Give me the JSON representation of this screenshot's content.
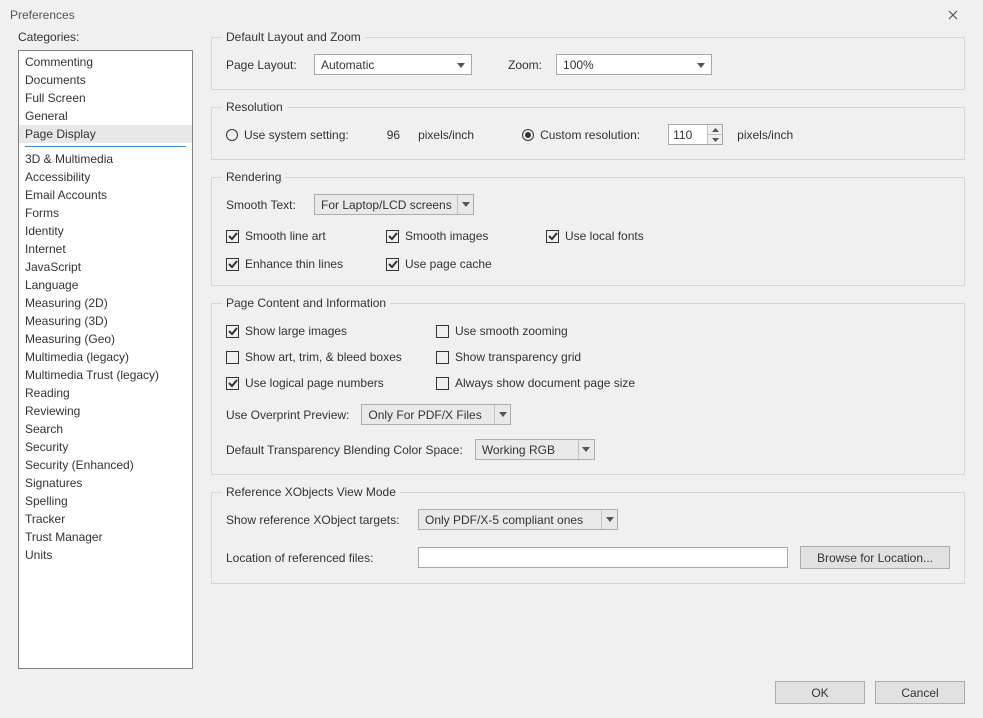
{
  "window": {
    "title": "Preferences"
  },
  "sidebar": {
    "label": "Categories:",
    "top": [
      "Commenting",
      "Documents",
      "Full Screen",
      "General",
      "Page Display"
    ],
    "selected": "Page Display",
    "rest": [
      "3D & Multimedia",
      "Accessibility",
      "Email Accounts",
      "Forms",
      "Identity",
      "Internet",
      "JavaScript",
      "Language",
      "Measuring (2D)",
      "Measuring (3D)",
      "Measuring (Geo)",
      "Multimedia (legacy)",
      "Multimedia Trust (legacy)",
      "Reading",
      "Reviewing",
      "Search",
      "Security",
      "Security (Enhanced)",
      "Signatures",
      "Spelling",
      "Tracker",
      "Trust Manager",
      "Units"
    ]
  },
  "layoutZoom": {
    "legend": "Default Layout and Zoom",
    "pageLayoutLabel": "Page Layout:",
    "pageLayoutValue": "Automatic",
    "zoomLabel": "Zoom:",
    "zoomValue": "100%"
  },
  "resolution": {
    "legend": "Resolution",
    "useSystemLabel": "Use system setting:",
    "systemValue": "96",
    "systemUnit": "pixels/inch",
    "customLabel": "Custom resolution:",
    "customValue": "110",
    "customUnit": "pixels/inch"
  },
  "rendering": {
    "legend": "Rendering",
    "smoothTextLabel": "Smooth Text:",
    "smoothTextValue": "For Laptop/LCD screens",
    "smoothLineArt": "Smooth line art",
    "smoothImages": "Smooth images",
    "useLocalFonts": "Use local fonts",
    "enhanceThinLines": "Enhance thin lines",
    "usePageCache": "Use page cache"
  },
  "pageContent": {
    "legend": "Page Content and Information",
    "showLargeImages": "Show large images",
    "useSmoothZoom": "Use smooth zooming",
    "showArtTrim": "Show art, trim, & bleed boxes",
    "showTransGrid": "Show transparency grid",
    "useLogicalPages": "Use logical page numbers",
    "alwaysShowSize": "Always show document page size",
    "overprintLabel": "Use Overprint Preview:",
    "overprintValue": "Only For PDF/X Files",
    "blendLabel": "Default Transparency Blending Color Space:",
    "blendValue": "Working RGB"
  },
  "xobjects": {
    "legend": "Reference XObjects View Mode",
    "targetsLabel": "Show reference XObject targets:",
    "targetsValue": "Only PDF/X-5 compliant ones",
    "locationLabel": "Location of referenced files:",
    "locationValue": "",
    "browseLabel": "Browse for Location..."
  },
  "footer": {
    "ok": "OK",
    "cancel": "Cancel"
  }
}
